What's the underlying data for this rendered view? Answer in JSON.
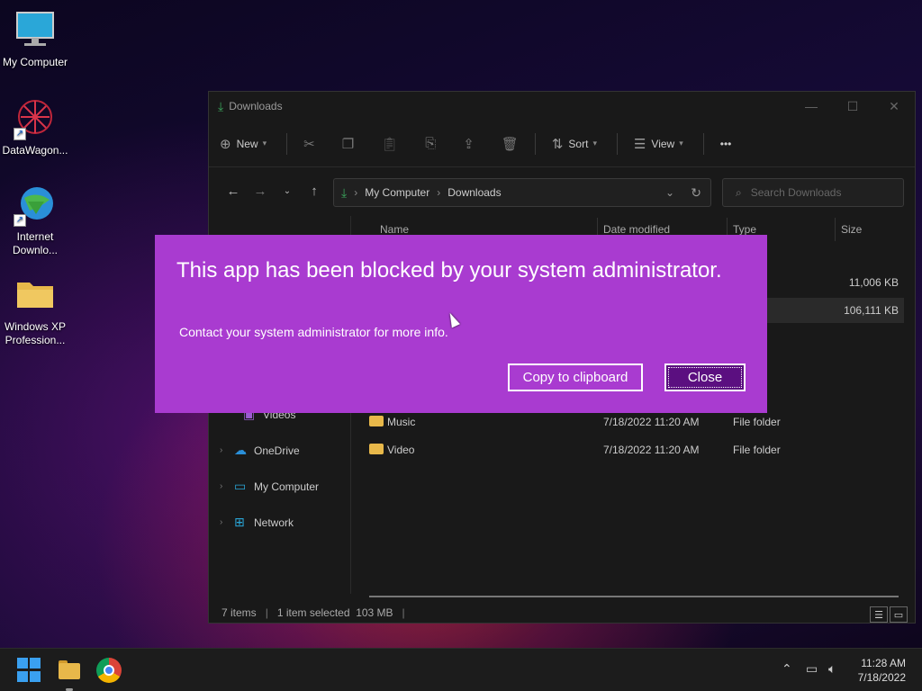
{
  "desktop": {
    "icons": [
      {
        "label": "My Computer"
      },
      {
        "label": "DataWagon..."
      },
      {
        "label": "Internet\nDownlo..."
      },
      {
        "label": "Windows XP\nProfession..."
      }
    ]
  },
  "explorer": {
    "title": "Downloads",
    "toolbar": {
      "new_label": "New",
      "sort_label": "Sort",
      "view_label": "View",
      "more_label": "•••"
    },
    "address": {
      "root": "My Computer",
      "current": "Downloads"
    },
    "search_placeholder": "Search Downloads",
    "sidebar": {
      "videos": "Videos",
      "onedrive": "OneDrive",
      "mycomputer": "My Computer",
      "network": "Network"
    },
    "columns": {
      "name": "Name",
      "date": "Date modified",
      "type": "Type",
      "size": "Size"
    },
    "rows": [
      {
        "name": "",
        "date": "",
        "type": "...ation",
        "size": "11,006 KB"
      },
      {
        "name": "",
        "date": "",
        "type": "...ation",
        "size": "106,111 KB"
      },
      {
        "name": "",
        "date": "",
        "type": "...older",
        "size": ""
      },
      {
        "name": "",
        "date": "",
        "type": "...older",
        "size": ""
      },
      {
        "name": "",
        "date": "",
        "type": "...older",
        "size": ""
      },
      {
        "name": "Music",
        "date": "7/18/2022 11:20 AM",
        "type": "File folder",
        "size": ""
      },
      {
        "name": "Video",
        "date": "7/18/2022 11:20 AM",
        "type": "File folder",
        "size": ""
      }
    ],
    "status": {
      "items": "7 items",
      "selected": "1 item selected  103 MB"
    }
  },
  "dialog": {
    "title": "This app has been blocked by your system administrator.",
    "message": "Contact your system administrator for more info.",
    "copy_label": "Copy to clipboard",
    "close_label": "Close",
    "bg_color": "#a93bd0"
  },
  "taskbar": {
    "time": "11:28 AM",
    "date": "7/18/2022"
  }
}
